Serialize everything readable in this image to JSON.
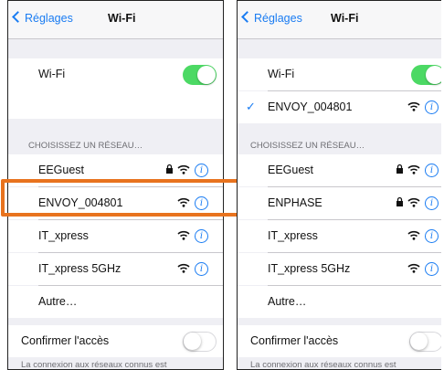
{
  "colors": {
    "accent": "#1a7cf2",
    "toggle_on": "#4cd964",
    "highlight": "#e8731e"
  },
  "left": {
    "back_label": "Réglages",
    "title": "Wi-Fi",
    "wifi_label": "Wi-Fi",
    "section_header": "CHOISISSEZ UN RÉSEAU…",
    "networks": [
      {
        "name": "EEGuest",
        "lock": true
      },
      {
        "name": "ENVOY_004801",
        "lock": false
      },
      {
        "name": "IT_xpress",
        "lock": false
      },
      {
        "name": "IT_xpress 5GHz",
        "lock": false
      }
    ],
    "other_label": "Autre…",
    "confirm_label": "Confirmer l'accès",
    "footer": "La connexion aux réseaux connus est"
  },
  "right": {
    "back_label": "Réglages",
    "title": "Wi-Fi",
    "wifi_label": "Wi-Fi",
    "connected_network": "ENVOY_004801",
    "section_header": "CHOISISSEZ UN RÉSEAU…",
    "networks": [
      {
        "name": "EEGuest",
        "lock": true
      },
      {
        "name": "ENPHASE",
        "lock": true
      },
      {
        "name": "IT_xpress",
        "lock": false
      },
      {
        "name": "IT_xpress 5GHz",
        "lock": false
      }
    ],
    "other_label": "Autre…",
    "confirm_label": "Confirmer l'accès",
    "footer": "La connexion aux réseaux connus est"
  }
}
